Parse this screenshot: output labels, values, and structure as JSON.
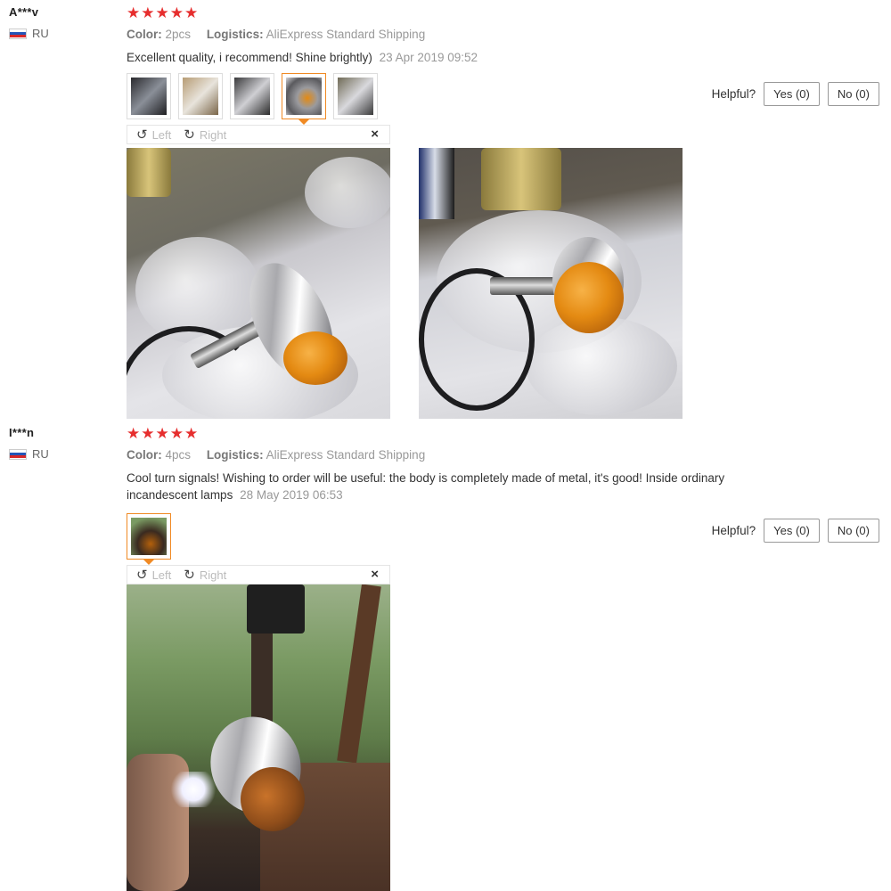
{
  "reviews": [
    {
      "user": "A***v",
      "country": "RU",
      "stars": "★★★★★",
      "color_label": "Color:",
      "color_value": "2pcs",
      "logistics_label": "Logistics:",
      "logistics_value": "AliExpress Standard Shipping",
      "text": "Excellent quality, i recommend! Shine brightly)",
      "date": "23 Apr 2019 09:52",
      "thumb_count": 5,
      "active_thumb": 4,
      "helpful_label": "Helpful?",
      "yes_label": "Yes (0)",
      "no_label": "No (0)",
      "viewer": {
        "left": "Left",
        "right": "Right",
        "close": "×"
      }
    },
    {
      "user": "I***n",
      "country": "RU",
      "stars": "★★★★★",
      "color_label": "Color:",
      "color_value": "4pcs",
      "logistics_label": "Logistics:",
      "logistics_value": "AliExpress Standard Shipping",
      "text": "Cool turn signals! Wishing to order will be useful: the body is completely made of metal, it's good! Inside ordinary incandescent lamps",
      "date": "28 May 2019 06:53",
      "thumb_count": 1,
      "active_thumb": 1,
      "helpful_label": "Helpful?",
      "yes_label": "Yes (0)",
      "no_label": "No (0)",
      "viewer": {
        "left": "Left",
        "right": "Right",
        "close": "×"
      }
    }
  ],
  "icons": {
    "rotate_left": "rotate-left-icon",
    "rotate_right": "rotate-right-icon",
    "close": "close-icon",
    "flag": "russia-flag-icon"
  },
  "colors": {
    "stars": "#e62e2e",
    "active_thumb_border": "#f08a24"
  }
}
